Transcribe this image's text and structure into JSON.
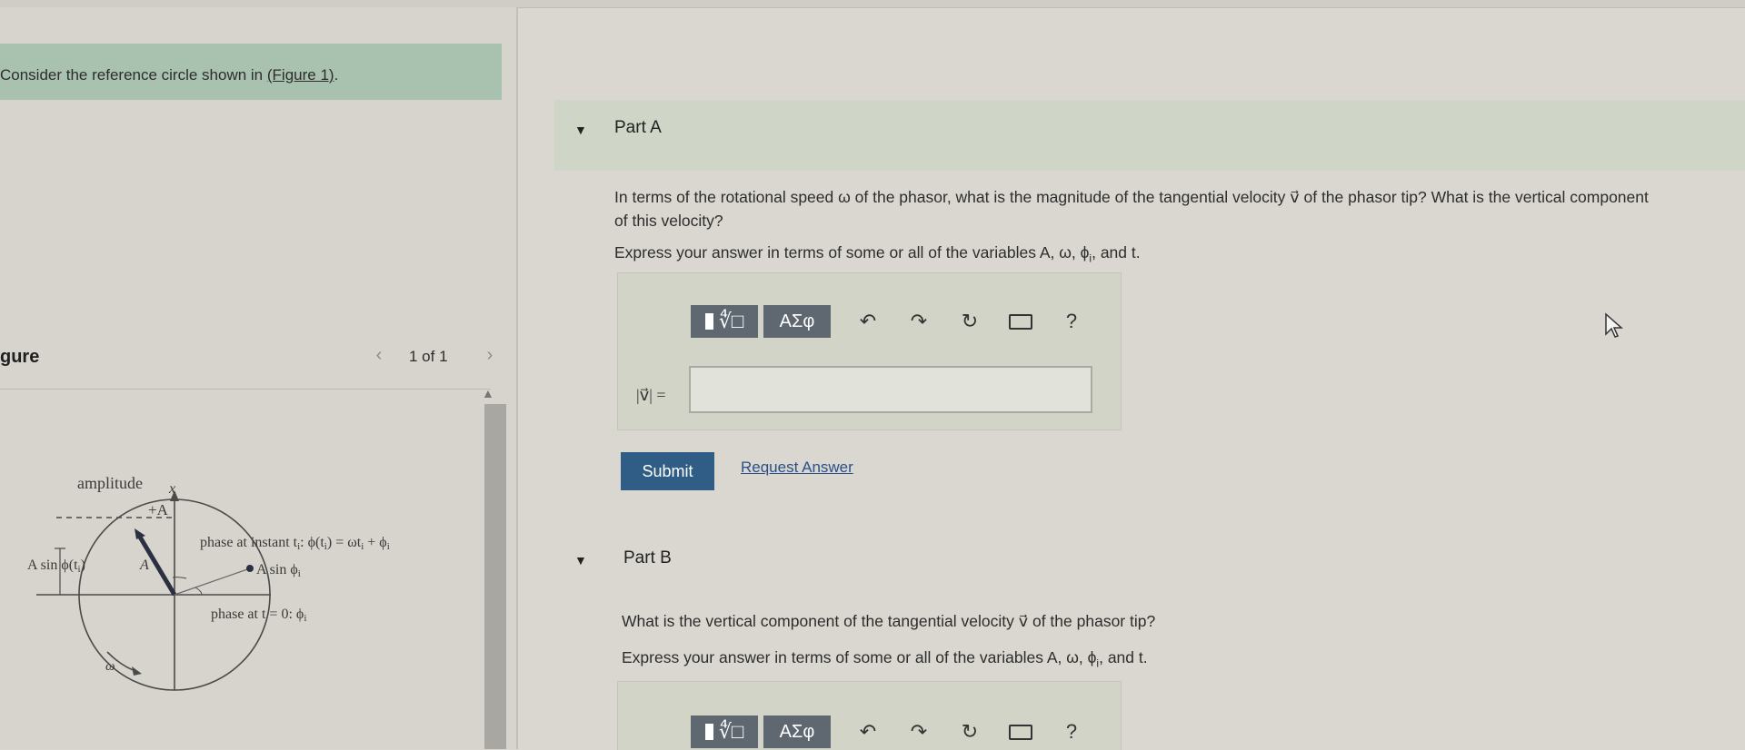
{
  "intro": {
    "text": "Consider the reference circle shown in ",
    "link": "(Figure 1)",
    "suffix": "."
  },
  "figure_panel": {
    "title": "gure",
    "counter": "1 of 1",
    "prev_icon": "chevron-left-icon",
    "next_icon": "chevron-right-icon",
    "labels": {
      "amplitude": "amplitude",
      "x": "x",
      "plus_a": "+A",
      "a_sin_phi_t": "A sin ϕ(t",
      "a_sin_phi_t_sub": "i",
      "a_sin_phi_t_close": ")",
      "a": "A",
      "phase_instant": "phase at instant t",
      "phase_instant_sub": "i",
      "phase_instant_eq": ": ϕ(t",
      "phase_instant_eq_sub": "i",
      "phase_instant_eq_rest": ") = ωt",
      "phase_instant_eq_sub2": "i",
      "phase_instant_eq_rest2": " + ϕ",
      "phase_instant_eq_sub3": "i",
      "a_sin_phi_i": "A sin ϕ",
      "a_sin_phi_i_sub": "i",
      "phase_at_zero": "phase at t = 0: ϕ",
      "phase_at_zero_sub": "i",
      "omega": "ω"
    }
  },
  "part_a": {
    "title": "Part A",
    "question_line1": "In terms of the rotational speed ω of the phasor, what is the magnitude of the tangential velocity v⃗ of the phasor tip? What is the vertical component",
    "question_line2": "of this velocity?",
    "instruction": "Express your answer in terms of some or all of the variables A, ω, ϕ",
    "instruction_sub": "i",
    "instruction_end": ", and t.",
    "toolbar": {
      "template_label": "∜□",
      "symbols_label": "ΑΣφ",
      "help_label": "?"
    },
    "answer_label": "|v⃗| =",
    "answer_value": "",
    "submit_label": "Submit",
    "request_label": "Request Answer"
  },
  "part_b": {
    "title": "Part B",
    "question": "What is the vertical component of the tangential velocity v⃗ of the phasor tip?",
    "instruction": "Express your answer in terms of some or all of the variables A, ω, ϕ",
    "instruction_sub": "i",
    "instruction_end": ", and t.",
    "toolbar": {
      "template_label": "∜□",
      "symbols_label": "ΑΣφ",
      "help_label": "?"
    }
  },
  "colors": {
    "accent_submit": "#2f5d86",
    "intro_box": "#a9c2b0",
    "toolbar_button": "#5f6770"
  }
}
